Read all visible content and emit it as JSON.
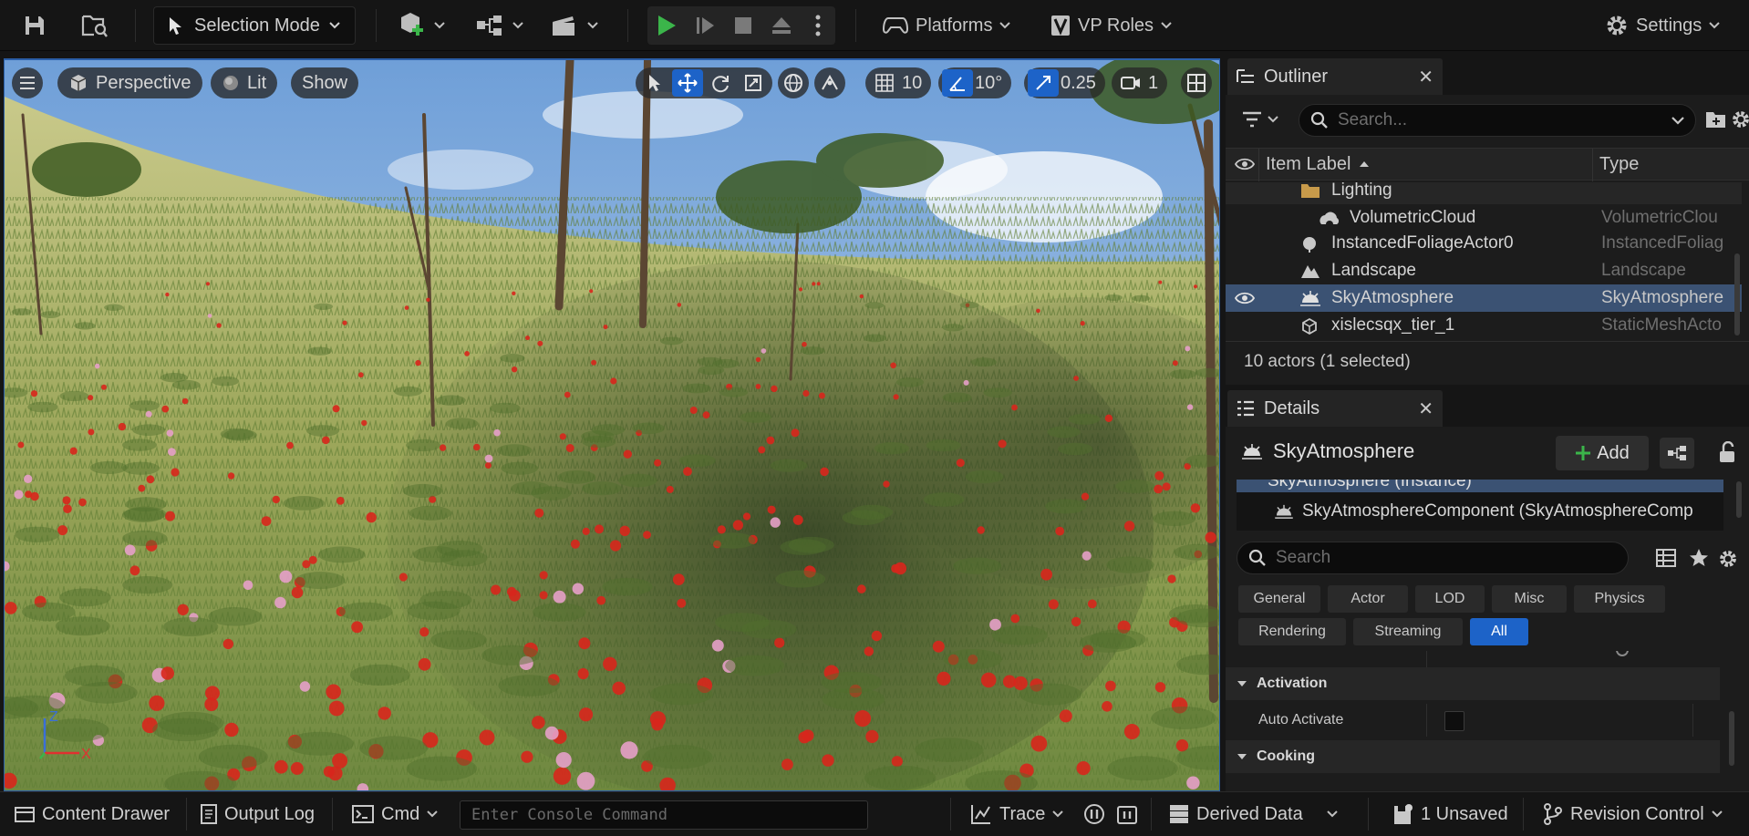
{
  "toolbar": {
    "mode": "Selection Mode",
    "platforms": "Platforms",
    "vp_roles": "VP Roles",
    "settings": "Settings"
  },
  "viewport": {
    "view": "Perspective",
    "lighting": "Lit",
    "show": "Show",
    "grid_snap": "10",
    "rotation_snap": "10°",
    "scale_snap": "0.25",
    "camera_speed": "1",
    "axis": {
      "z": "Z",
      "x": "X"
    }
  },
  "outliner": {
    "tab": "Outliner",
    "search_placeholder": "Search...",
    "col_label": "Item Label",
    "col_type": "Type",
    "rows": [
      {
        "label": "Lighting",
        "type": "",
        "icon": "folder-icon"
      },
      {
        "label": "VolumetricCloud",
        "type": "VolumetricClou",
        "icon": "cloud-icon"
      },
      {
        "label": "InstancedFoliageActor0",
        "type": "InstancedFoliag",
        "icon": "foliage-icon"
      },
      {
        "label": "Landscape",
        "type": "Landscape",
        "icon": "landscape-icon"
      },
      {
        "label": "SkyAtmosphere",
        "type": "SkyAtmosphere",
        "icon": "sky-icon"
      },
      {
        "label": "xislecsqx_tier_1",
        "type": "StaticMeshActo",
        "icon": "cube-icon"
      }
    ],
    "footer": "10 actors (1 selected)"
  },
  "details": {
    "tab": "Details",
    "object": "SkyAtmosphere",
    "add": "Add",
    "tree_instance": "SkyAtmosphere (Instance)",
    "tree_component": "SkyAtmosphereComponent (SkyAtmosphereComp",
    "search_placeholder": "Search",
    "categories_row1": [
      "General",
      "Actor",
      "LOD",
      "Misc",
      "Physics"
    ],
    "categories_row2": [
      "Rendering",
      "Streaming",
      "All"
    ],
    "active_category": "All",
    "sections": {
      "activation": "Activation",
      "auto_activate": "Auto Activate",
      "cooking": "Cooking"
    }
  },
  "bottombar": {
    "content_drawer": "Content Drawer",
    "output_log": "Output Log",
    "cmd": "Cmd",
    "console_placeholder": "Enter Console Command",
    "trace": "Trace",
    "derived_data": "Derived Data",
    "unsaved": "1 Unsaved",
    "revision_control": "Revision Control"
  },
  "colors": {
    "accent": "#1d63c8",
    "selection": "#3b5273",
    "play_green": "#3bb54a"
  }
}
